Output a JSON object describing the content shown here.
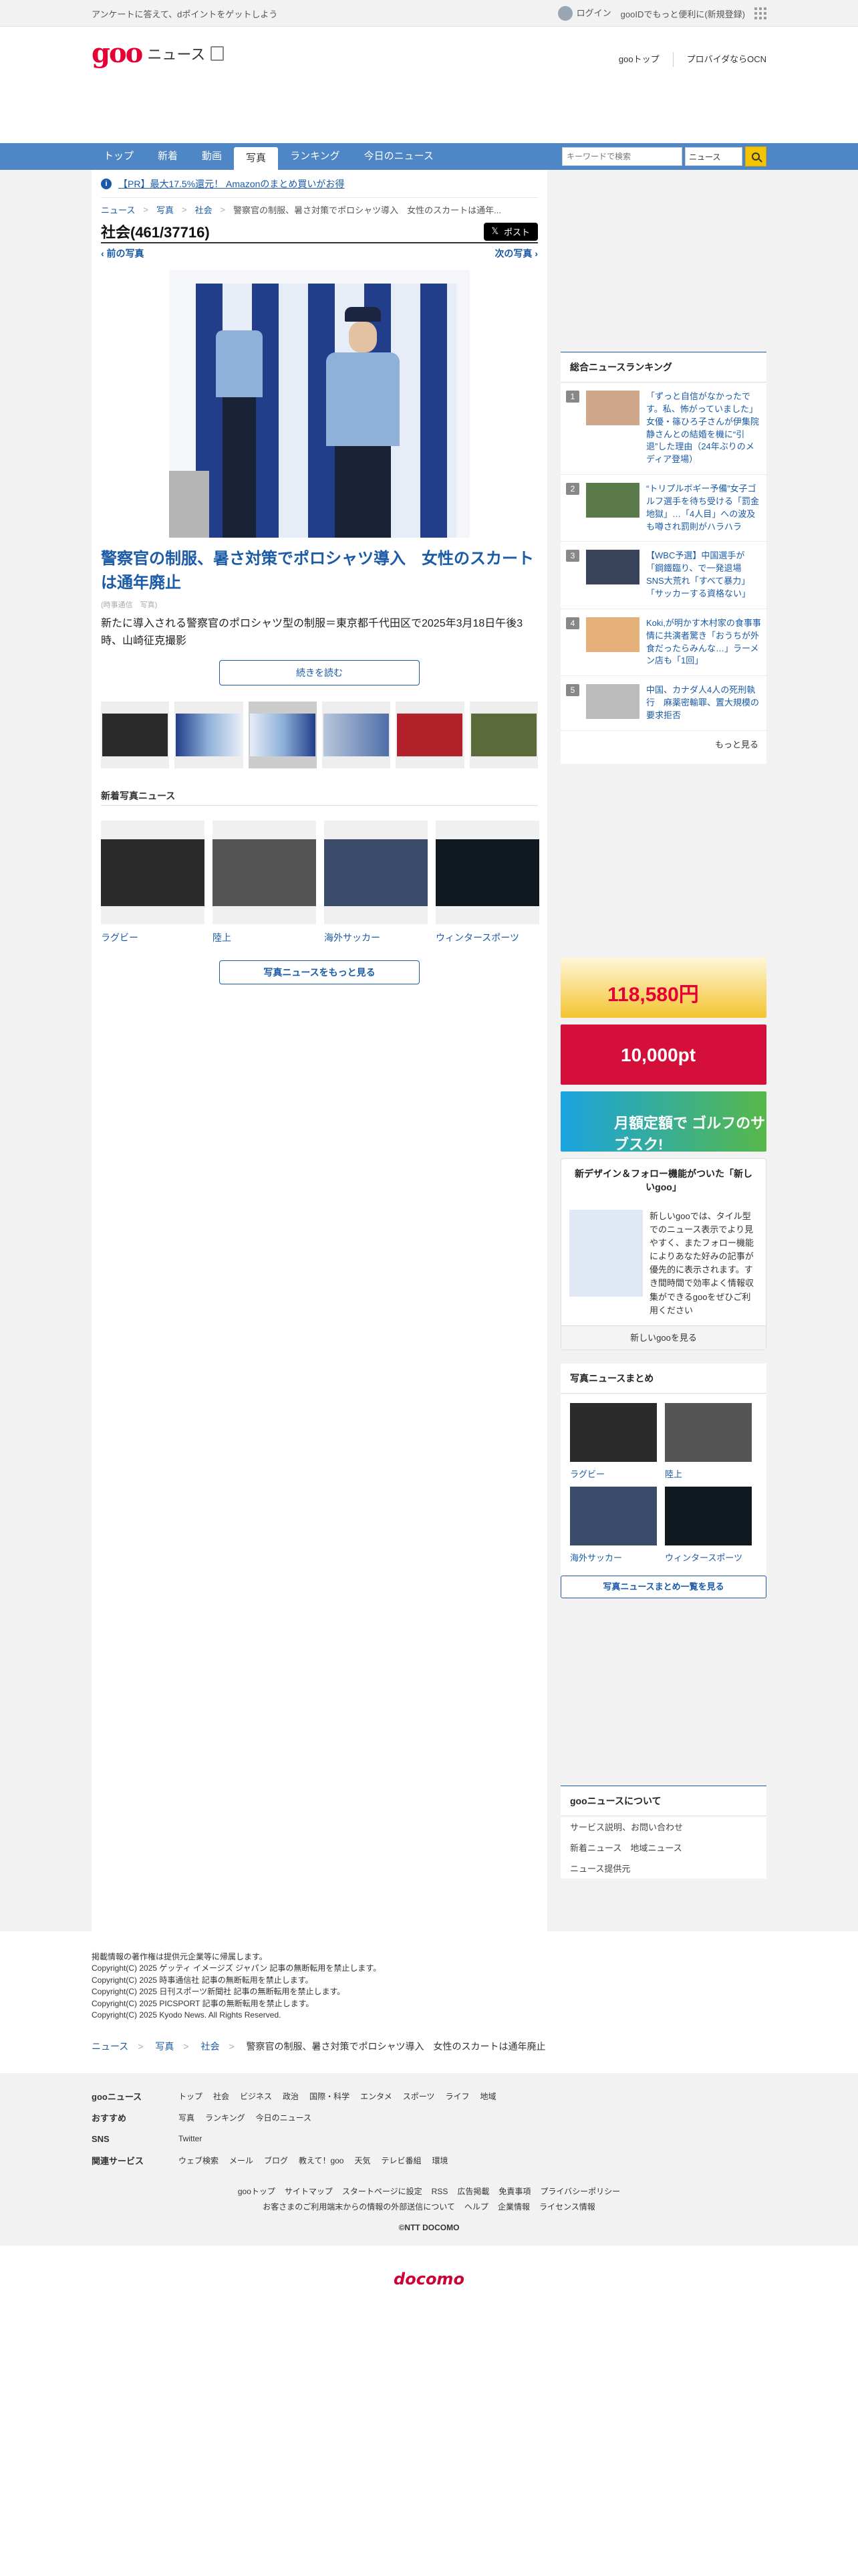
{
  "topbar": {
    "promo": "アンケートに答えて、dポイントをゲットしよう",
    "login": "ログイン",
    "register": "gooIDでもっと便利に(新規登録)"
  },
  "header": {
    "logo": "goo",
    "section": "ニュース",
    "link1": "gooトップ",
    "link2": "プロバイダならOCN"
  },
  "nav": {
    "tabs": [
      "トップ",
      "新着",
      "動画",
      "写真",
      "ランキング",
      "今日のニュース"
    ],
    "active": 3,
    "search_placeholder": "キーワードで検索",
    "search_scope": "ニュース"
  },
  "promo": {
    "text": "【PR】最大17.5%還元！ Amazonのまとめ買いがお得"
  },
  "breadcrumb": [
    "ニュース",
    "写真",
    "社会",
    "警察官の制服、暑さ対策でポロシャツ導入　女性のスカートは通年..."
  ],
  "gallery": {
    "title": "社会(461/37716)",
    "share": "ポスト",
    "prev": "‹ 前の写真",
    "next": "次の写真 ›"
  },
  "article": {
    "headline": "警察官の制服、暑さ対策でポロシャツ導入　女性のスカートは通年廃止",
    "credit": "(時事通信　写真)",
    "caption": "新たに導入される警察官のポロシャツ型の制服＝東京都千代田区で2025年3月18日午後3時、山崎征克撮影",
    "read_more": "続きを読む"
  },
  "latest": {
    "title": "新着写真ニュース",
    "items": [
      "ラグビー",
      "陸上",
      "海外サッカー",
      "ウィンタースポーツ"
    ],
    "more": "写真ニュースをもっと見る"
  },
  "ranking": {
    "title": "総合ニュースランキング",
    "items": [
      {
        "num": "1",
        "text": "「ずっと自信がなかったです。私、怖がっていました」女優・篠ひろ子さんが伊集院静さんとの結婚を機に“引退”した理由（24年ぶりのメディア登場）"
      },
      {
        "num": "2",
        "text": "“トリプルボギー予備”女子ゴルフ選手を待ち受ける「罰金地獄」…「4人目」への波及も噂され罰則がハラハラ"
      },
      {
        "num": "3",
        "text": "【WBC予選】中国選手が「鋼鐵臨り、で一発退場 SNS大荒れ「すべて暴力」「サッカーする資格ない」"
      },
      {
        "num": "4",
        "text": "Koki,が明かす木村家の食事事情に共演者驚き「おうちが外食だったらみんな…」ラーメン店も「1回」"
      },
      {
        "num": "5",
        "text": "中国、カナダ人4人の死刑執行　麻薬密輸罪、置大規模の要求拒否"
      }
    ],
    "more": "もっと見る"
  },
  "ads": {
    "ad1": "118,580円",
    "ad2": "10,000pt",
    "ad3": "月額定額で ゴルフのサブスク!"
  },
  "goo_box": {
    "title": "新デザイン＆フォロー機能がついた「新しいgoo」",
    "text": "新しいgooでは、タイル型でのニュース表示でより見やすく、またフォロー機能によりあなた好みの記事が優先的に表示されます。すき間時間で効率よく情報収集ができるgooをぜひご利用ください",
    "button": "新しいgooを見る"
  },
  "summary": {
    "title": "写真ニュースまとめ",
    "items": [
      "ラグビー",
      "陸上",
      "海外サッカー",
      "ウィンタースポーツ"
    ],
    "button": "写真ニュースまとめ一覧を見る"
  },
  "about": {
    "title": "gooニュースについて",
    "links": [
      "サービス説明、お問い合わせ",
      "新着ニュース　地域ニュース",
      "ニュース提供元"
    ]
  },
  "copyright": [
    "掲載情報の著作権は提供元企業等に帰属します。",
    "Copyright(C) 2025 ゲッティ イメージズ ジャパン 記事の無断転用を禁止します。",
    "Copyright(C) 2025 時事通信社 記事の無断転用を禁止します。",
    "Copyright(C) 2025 日刊スポーツ新聞社 記事の無断転用を禁止します。",
    "Copyright(C) 2025 PICSPORT 記事の無断転用を禁止します。",
    "Copyright(C) 2025 Kyodo News. All Rights Reserved."
  ],
  "footer_crumb": [
    "ニュース",
    "写真",
    "社会",
    "警察官の制服、暑さ対策でポロシャツ導入　女性のスカートは通年廃止"
  ],
  "footer": {
    "rows": [
      {
        "label": "gooニュース",
        "items": [
          "トップ",
          "社会",
          "ビジネス",
          "政治",
          "国際・科学",
          "エンタメ",
          "スポーツ",
          "ライフ",
          "地域"
        ]
      },
      {
        "label": "おすすめ",
        "items": [
          "写真",
          "ランキング",
          "今日のニュース"
        ]
      },
      {
        "label": "SNS",
        "items": [
          "Twitter"
        ]
      },
      {
        "label": "関連サービス",
        "items": [
          "ウェブ検索",
          "メール",
          "ブログ",
          "教えて！goo",
          "天気",
          "テレビ番組",
          "環境"
        ]
      }
    ],
    "links1": [
      "gooトップ",
      "サイトマップ",
      "スタートページに設定",
      "RSS",
      "広告掲載",
      "免責事項",
      "プライバシーポリシー"
    ],
    "links2": [
      "お客さまのご利用端末からの情報の外部送信について",
      "ヘルプ",
      "企業情報",
      "ライセンス情報"
    ],
    "copy": "©NTT DOCOMO",
    "brand": "docomo"
  }
}
